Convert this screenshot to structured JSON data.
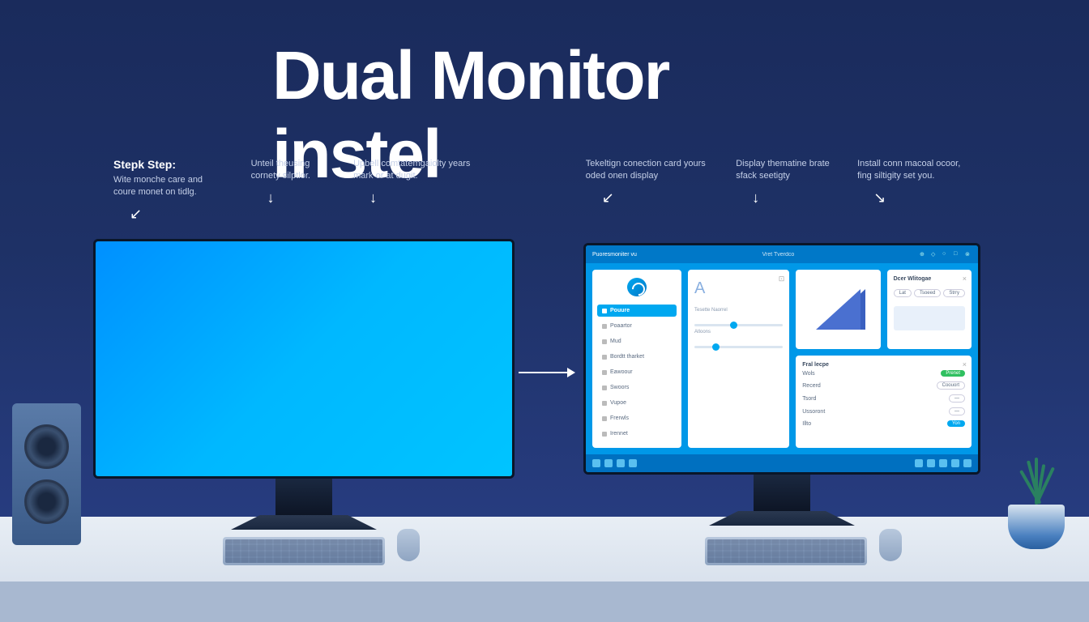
{
  "title": "Dual Monitor instel",
  "steps": [
    {
      "title": "Stepk Step:",
      "text": "Wite monche care and coure monet on tidlg."
    },
    {
      "title": "",
      "text": "Unteil theusing cornety silptlor."
    },
    {
      "title": "",
      "text": "Upbell comtatemgaiolty years mark or at dugit."
    },
    {
      "title": "",
      "text": "Tekeltign conection card yours oded onen display"
    },
    {
      "title": "",
      "text": "Display thematine brate sfack seetigty"
    },
    {
      "title": "",
      "text": "Install conn macoal ocoor, fing siltigity set you."
    }
  ],
  "monitor_logo": "vu",
  "app": {
    "titlebar": "Puoresmoniter vu",
    "subtitle": "Vret Tverdco",
    "sidebar": {
      "active": "Pouure",
      "items": [
        "Poaartor",
        "Mud",
        "Bordtt tharket",
        "Eawoour",
        "Swoors",
        "Vupoe",
        "Frerwls",
        "Irennet"
      ]
    },
    "card_a": {
      "big": "A",
      "l1": "Tesette Naorrel",
      "l2": "Atloons"
    },
    "card_b_label": "",
    "card_c": {
      "title": "Dcer Wlitogae",
      "buttons": [
        "Lat",
        "Tsoeed",
        "Strry"
      ]
    },
    "card_d": {
      "title": "Fral lecpe",
      "sub": "Wols",
      "rows": [
        "Recerd",
        "Tsord",
        "Ussoront",
        "Illto"
      ]
    }
  }
}
